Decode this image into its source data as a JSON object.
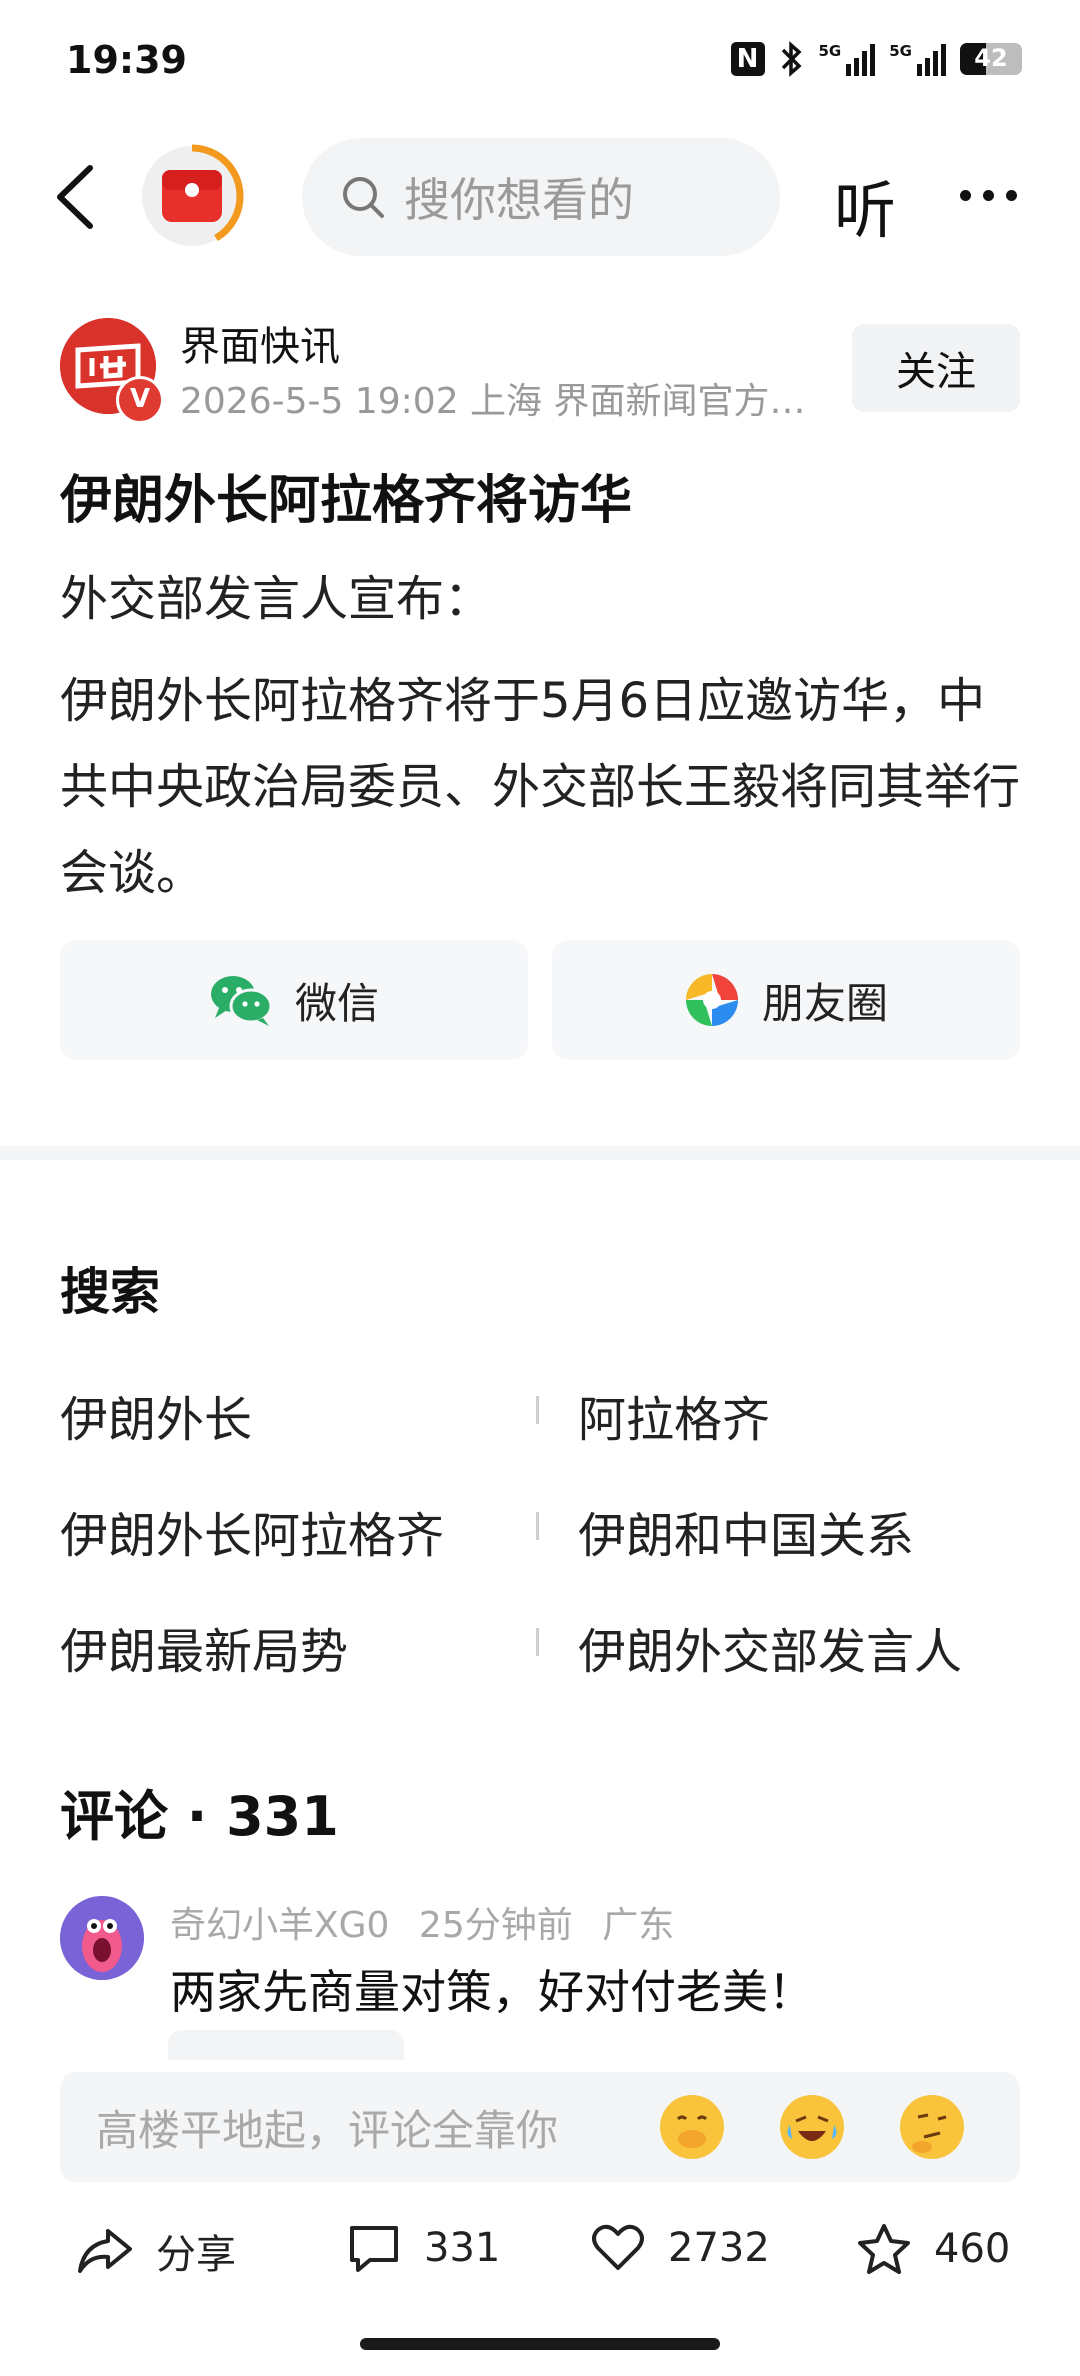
{
  "status_bar": {
    "time": "19:39",
    "network_5g_1": "5G",
    "network_5g_2": "5G",
    "battery": "42",
    "battery_level": 0.42,
    "nfc": "N"
  },
  "nav": {
    "search_placeholder": "搜你想看的",
    "listen_label": "听"
  },
  "author": {
    "name": "界面快讯",
    "badge": "V",
    "meta": "2026-5-5  19:02  上海  界面新闻官方账...",
    "follow_label": "关注"
  },
  "article": {
    "title": "伊朗外长阿拉格齐将访华",
    "paragraphs": [
      "外交部发言人宣布：",
      "伊朗外长阿拉格齐将于5月6日应邀访华，中共中央政治局委员、外交部长王毅将同其举行会谈。"
    ]
  },
  "share": {
    "wechat_label": "微信",
    "moments_label": "朋友圈"
  },
  "search_section": {
    "title": "搜索",
    "keywords": [
      "伊朗外长",
      "阿拉格齐",
      "伊朗外长阿拉格齐",
      "伊朗和中国关系",
      "伊朗最新局势",
      "伊朗外交部发言人"
    ]
  },
  "comments": {
    "title": "评论 · 331",
    "items": [
      {
        "user": "奇幻小羊XG0",
        "time": "25分钟前",
        "location": "广东",
        "text": "两家先商量对策，好对付老美！"
      }
    ]
  },
  "input_bar": {
    "placeholder": "高楼平地起，评论全靠你",
    "emojis": [
      "cover-mouth-emoji",
      "laugh-cry-emoji",
      "thinking-emoji"
    ]
  },
  "actions": {
    "share_label": "分享",
    "comment_count": "331",
    "like_count": "2732",
    "favorite_count": "460"
  },
  "colors": {
    "brand_red": "#d8322b",
    "accent_orange": "#f39a1e",
    "wechat_green": "#2aae67"
  }
}
